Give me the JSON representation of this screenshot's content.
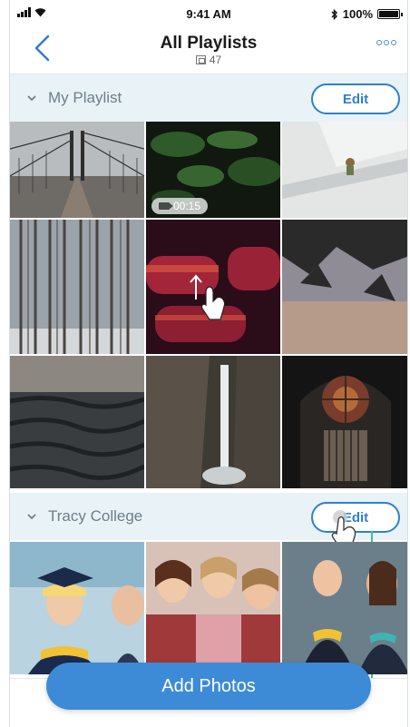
{
  "status_bar": {
    "time": "9:41 AM",
    "battery": "100%"
  },
  "header": {
    "title": "All Playlists",
    "photo_count": "47"
  },
  "sections": [
    {
      "name": "My Playlist",
      "edit_label": "Edit"
    },
    {
      "name": "Tracy College",
      "edit_label": "Edit"
    }
  ],
  "video_badge": {
    "duration": "00:15"
  },
  "add_photos_label": "Add Photos",
  "colors": {
    "accent": "#2f7fcf",
    "section_bg": "#e9f2f6",
    "add_button": "#3d8bd6"
  }
}
